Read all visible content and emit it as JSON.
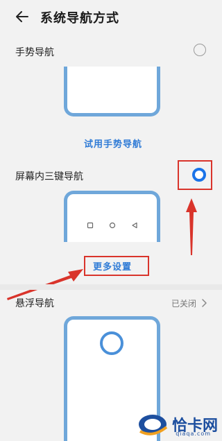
{
  "header": {
    "title": "系统导航方式",
    "back_icon": "arrow-left-icon"
  },
  "gesture_nav": {
    "label": "手势导航",
    "selected": false,
    "try_link": "试用手势导航"
  },
  "three_key_nav": {
    "label": "屏幕内三键导航",
    "selected": true,
    "more_settings": "更多设置",
    "keys": [
      "square-icon",
      "circle-icon",
      "triangle-back-icon"
    ]
  },
  "floating_nav": {
    "label": "悬浮导航",
    "status": "已关闭",
    "chevron_icon": "chevron-right-icon"
  },
  "annotations": {
    "highlight_color": "#d9342b"
  },
  "watermark": {
    "text": "恰卡网",
    "domain": "qiaqa.com"
  },
  "colors": {
    "accent": "#1a73e8",
    "phone_frame": "#6fa7da",
    "link": "#2f7bd6"
  }
}
